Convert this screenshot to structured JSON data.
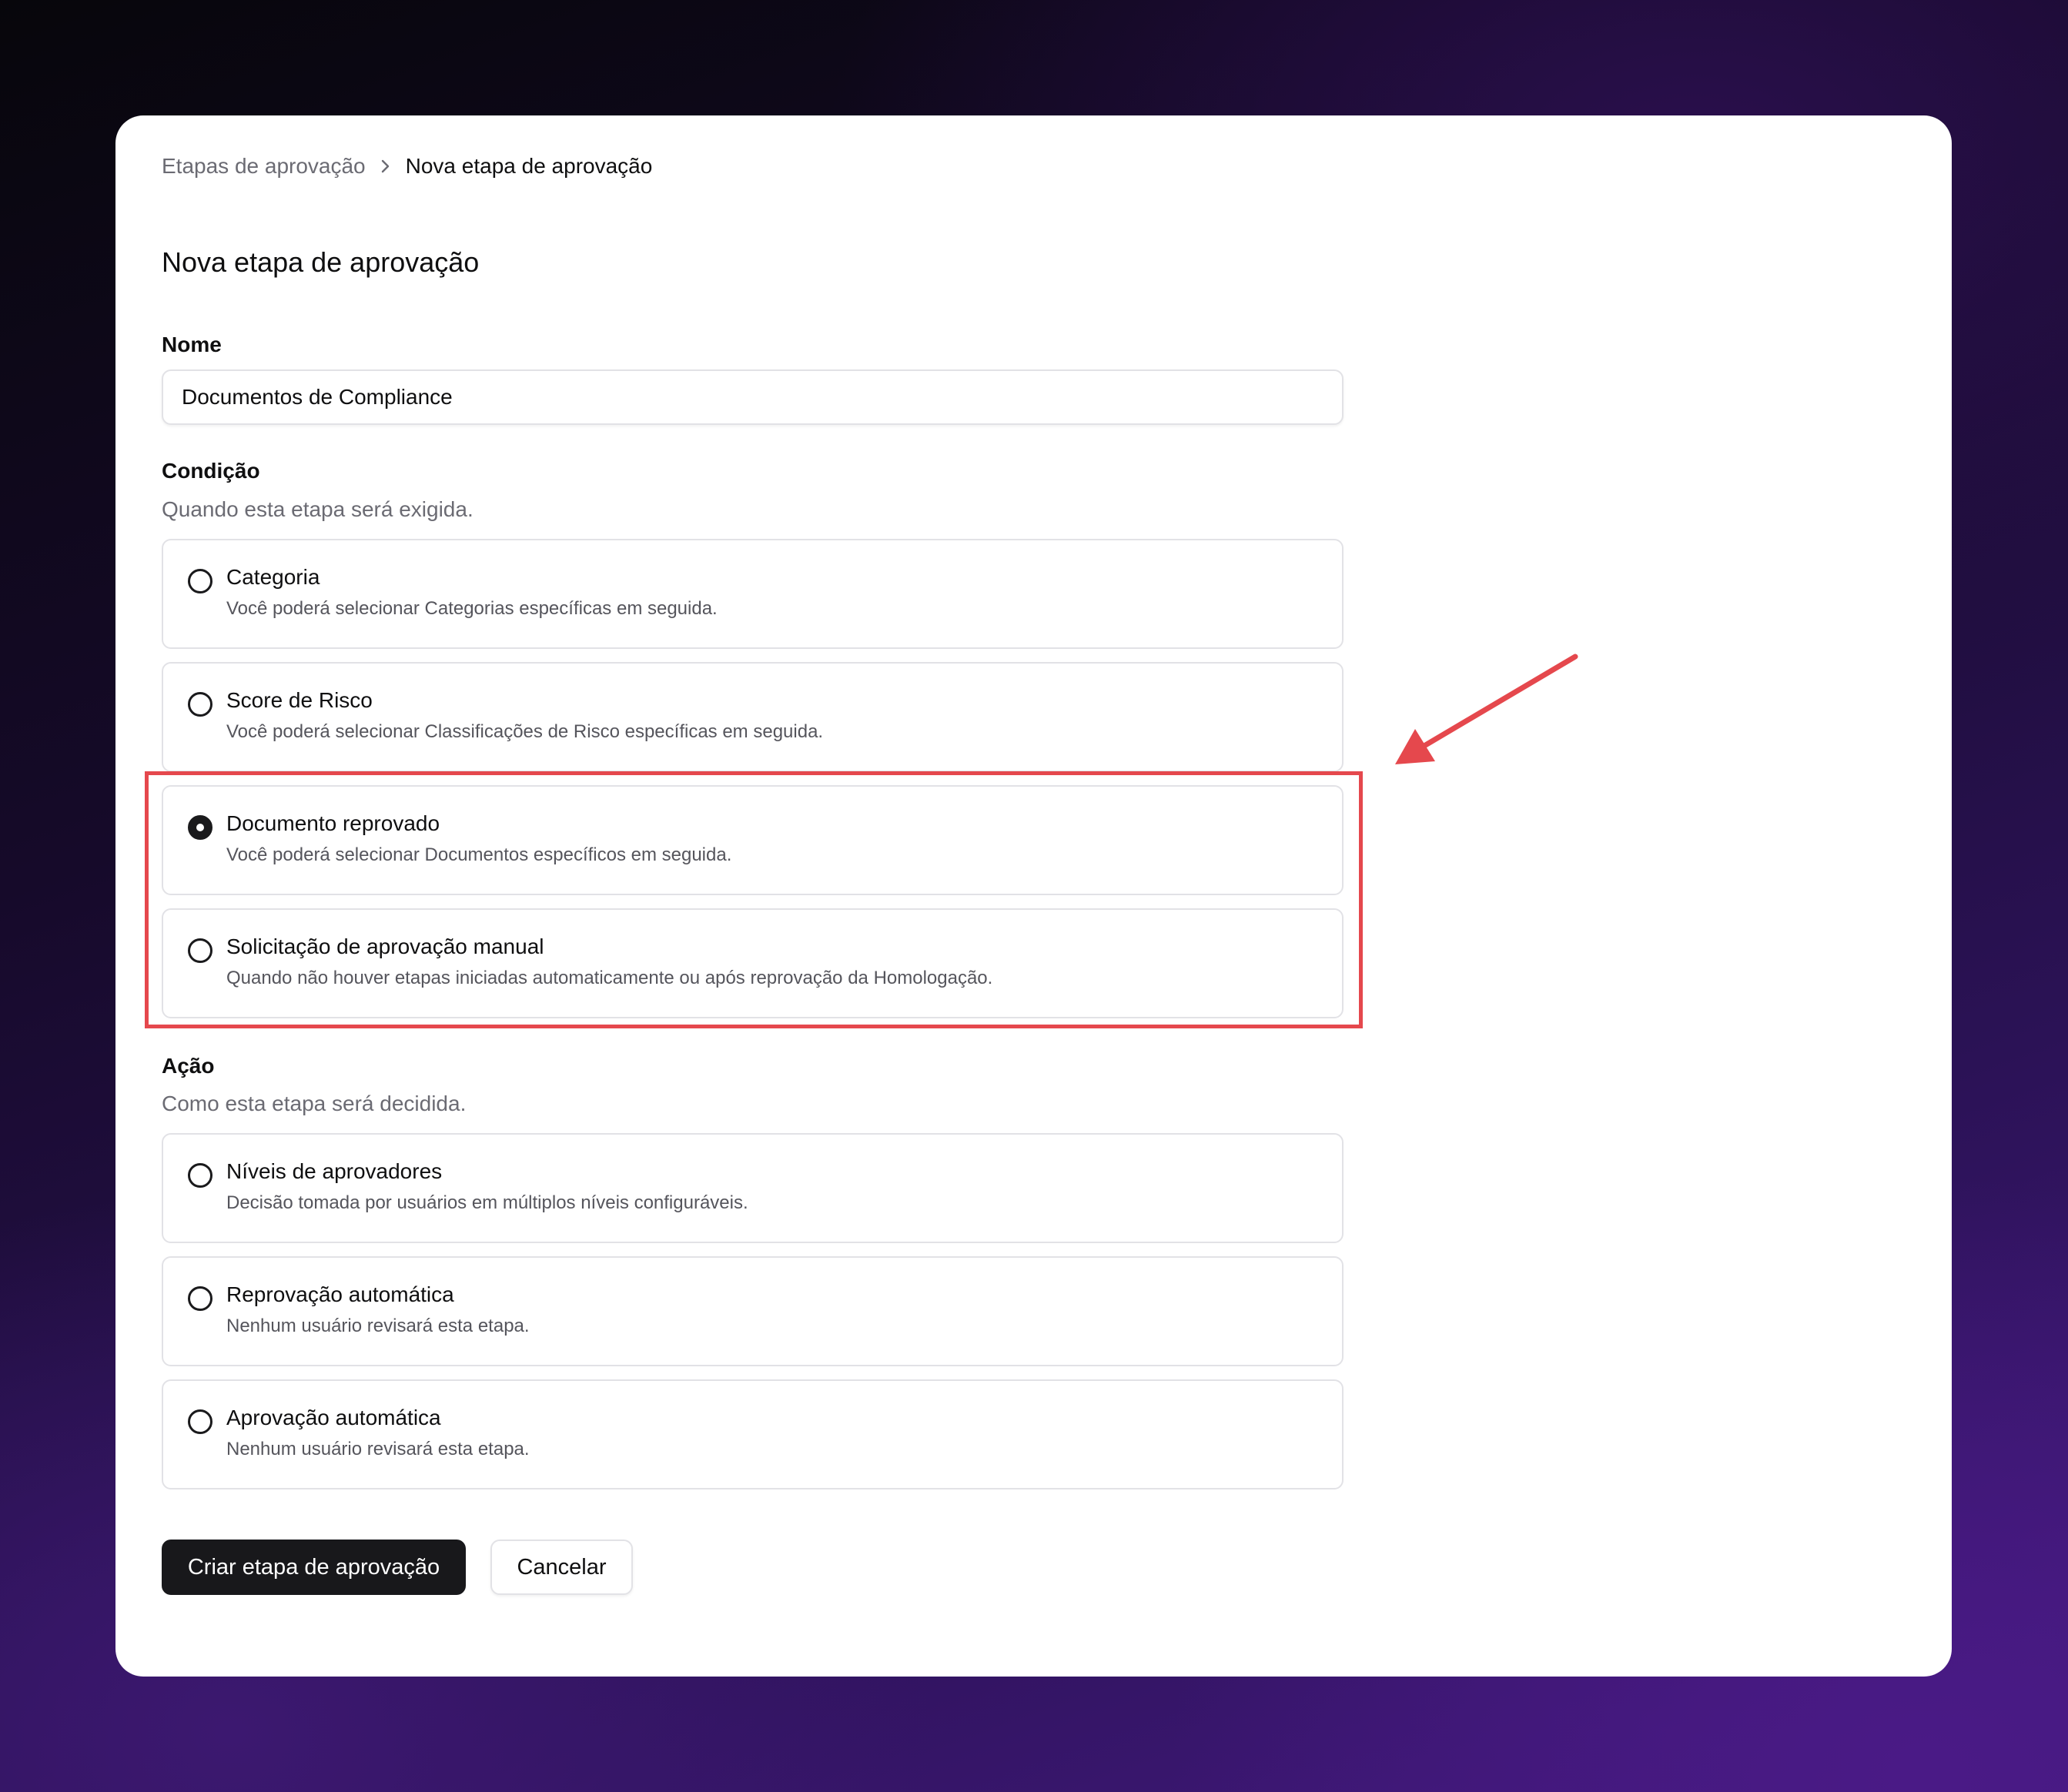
{
  "breadcrumb": {
    "parent": "Etapas de aprovação",
    "current": "Nova etapa de aprovação"
  },
  "page": {
    "title": "Nova etapa de aprovação"
  },
  "name_field": {
    "label": "Nome",
    "value": "Documentos de Compliance"
  },
  "condition": {
    "label": "Condição",
    "description": "Quando esta etapa será exigida.",
    "selected": "Documento reprovado",
    "options": [
      {
        "title": "Categoria",
        "description": "Você poderá selecionar Categorias específicas em seguida."
      },
      {
        "title": "Score de Risco",
        "description": "Você poderá selecionar Classificações de Risco específicas em seguida."
      },
      {
        "title": "Documento reprovado",
        "description": "Você poderá selecionar Documentos específicos em seguida."
      },
      {
        "title": "Solicitação de aprovação manual",
        "description": "Quando não houver etapas iniciadas automaticamente ou após reprovação da Homologação."
      }
    ]
  },
  "action": {
    "label": "Ação",
    "description": "Como esta etapa será decidida.",
    "selected": null,
    "options": [
      {
        "title": "Níveis de aprovadores",
        "description": "Decisão tomada por usuários em múltiplos níveis configuráveis."
      },
      {
        "title": "Reprovação automática",
        "description": "Nenhum usuário revisará esta etapa."
      },
      {
        "title": "Aprovação automática",
        "description": "Nenhum usuário revisará esta etapa."
      }
    ]
  },
  "buttons": {
    "submit": "Criar etapa de aprovação",
    "cancel": "Cancelar"
  },
  "colors": {
    "annotation": "#e5484d",
    "primary_button": "#18181b",
    "border": "#e2e2e6"
  },
  "icons": {
    "breadcrumb_separator": "chevron-right-icon",
    "annotation_arrow": "arrow-icon"
  }
}
